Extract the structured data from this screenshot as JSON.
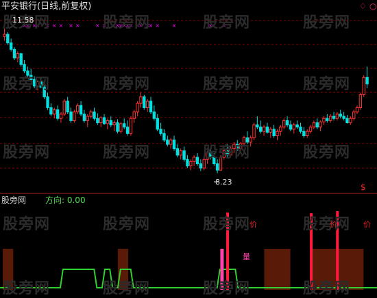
{
  "header": {
    "title": "平安银行(日线,前复权)",
    "settings_glyph": "♢",
    "close_glyph": "○"
  },
  "price": {
    "high_label": "11.58",
    "low_label": "8.23",
    "high_value": 11.58,
    "low_value": 8.23,
    "dollar_marker": "$"
  },
  "indicator": {
    "name": "股旁网",
    "direction_label": "方向: 0.00"
  },
  "watermark": "股旁网",
  "signals": {
    "price_tag": "价",
    "volume_tag": "量"
  },
  "colors": {
    "up": "#ff3232",
    "down": "#00e0e0",
    "grid": "#8b0000",
    "direction_line": "#30d030",
    "band": "#5a1a08",
    "signal_bar": "#ff1a3c",
    "marker": "#ff00ff"
  },
  "chart_data": {
    "type": "candlestick",
    "y_range": [
      8.0,
      11.8
    ],
    "candles": [
      [
        11.4,
        11.58,
        11.3,
        11.45
      ],
      [
        11.45,
        11.5,
        11.2,
        11.25
      ],
      [
        11.25,
        11.35,
        11.05,
        11.1
      ],
      [
        11.1,
        11.15,
        10.85,
        10.9
      ],
      [
        10.9,
        11.05,
        10.8,
        11.0
      ],
      [
        11.0,
        11.02,
        10.7,
        10.75
      ],
      [
        10.75,
        10.85,
        10.55,
        10.6
      ],
      [
        10.6,
        10.7,
        10.45,
        10.5
      ],
      [
        10.5,
        10.65,
        10.35,
        10.4
      ],
      [
        10.4,
        10.48,
        10.2,
        10.25
      ],
      [
        10.25,
        10.4,
        10.15,
        10.35
      ],
      [
        10.35,
        10.45,
        10.2,
        10.22
      ],
      [
        10.22,
        10.3,
        9.95,
        10.0
      ],
      [
        10.0,
        10.1,
        9.7,
        9.75
      ],
      [
        9.75,
        9.85,
        9.55,
        9.6
      ],
      [
        9.6,
        9.75,
        9.5,
        9.7
      ],
      [
        9.7,
        9.8,
        9.45,
        9.5
      ],
      [
        9.5,
        9.65,
        9.4,
        9.6
      ],
      [
        9.6,
        9.95,
        9.55,
        9.9
      ],
      [
        9.9,
        10.0,
        9.6,
        9.65
      ],
      [
        9.65,
        9.75,
        9.4,
        9.45
      ],
      [
        9.45,
        9.7,
        9.4,
        9.65
      ],
      [
        9.65,
        9.85,
        9.6,
        9.8
      ],
      [
        9.8,
        9.9,
        9.55,
        9.6
      ],
      [
        9.6,
        9.7,
        9.4,
        9.45
      ],
      [
        9.45,
        9.6,
        9.3,
        9.55
      ],
      [
        9.55,
        9.7,
        9.5,
        9.65
      ],
      [
        9.65,
        9.75,
        9.45,
        9.5
      ],
      [
        9.5,
        9.62,
        9.35,
        9.4
      ],
      [
        9.4,
        9.55,
        9.3,
        9.52
      ],
      [
        9.52,
        9.6,
        9.35,
        9.38
      ],
      [
        9.38,
        9.5,
        9.25,
        9.45
      ],
      [
        9.45,
        9.55,
        9.3,
        9.35
      ],
      [
        9.35,
        9.45,
        9.2,
        9.4
      ],
      [
        9.4,
        9.48,
        9.15,
        9.2
      ],
      [
        9.2,
        9.42,
        9.15,
        9.38
      ],
      [
        9.38,
        9.5,
        9.25,
        9.3
      ],
      [
        9.3,
        9.45,
        9.1,
        9.15
      ],
      [
        9.15,
        9.55,
        9.1,
        9.5
      ],
      [
        9.5,
        9.7,
        9.4,
        9.65
      ],
      [
        9.65,
        9.9,
        9.55,
        9.85
      ],
      [
        9.85,
        10.1,
        9.75,
        10.0
      ],
      [
        10.0,
        10.05,
        9.7,
        9.75
      ],
      [
        9.75,
        9.95,
        9.65,
        9.9
      ],
      [
        9.9,
        10.0,
        9.6,
        9.65
      ],
      [
        9.65,
        9.8,
        9.45,
        9.5
      ],
      [
        9.5,
        9.6,
        9.2,
        9.25
      ],
      [
        9.25,
        9.4,
        9.1,
        9.15
      ],
      [
        9.15,
        9.25,
        8.95,
        9.0
      ],
      [
        9.0,
        9.1,
        8.85,
        8.9
      ],
      [
        8.9,
        9.05,
        8.8,
        9.0
      ],
      [
        9.0,
        9.1,
        8.75,
        8.8
      ],
      [
        8.8,
        8.9,
        8.6,
        8.65
      ],
      [
        8.65,
        8.8,
        8.55,
        8.75
      ],
      [
        8.75,
        8.85,
        8.5,
        8.55
      ],
      [
        8.55,
        8.65,
        8.35,
        8.4
      ],
      [
        8.4,
        8.55,
        8.3,
        8.5
      ],
      [
        8.5,
        8.65,
        8.4,
        8.6
      ],
      [
        8.6,
        8.7,
        8.4,
        8.45
      ],
      [
        8.45,
        8.55,
        8.28,
        8.35
      ],
      [
        8.35,
        8.6,
        8.3,
        8.55
      ],
      [
        8.55,
        8.75,
        8.45,
        8.7
      ],
      [
        8.7,
        8.8,
        8.55,
        8.6
      ],
      [
        8.6,
        8.7,
        8.4,
        8.45
      ],
      [
        8.45,
        8.55,
        8.23,
        8.3
      ],
      [
        8.3,
        8.65,
        8.28,
        8.6
      ],
      [
        8.6,
        8.8,
        8.55,
        8.75
      ],
      [
        8.75,
        8.9,
        8.6,
        8.65
      ],
      [
        8.65,
        8.85,
        8.6,
        8.8
      ],
      [
        8.8,
        8.95,
        8.7,
        8.9
      ],
      [
        8.9,
        9.0,
        8.75,
        8.8
      ],
      [
        8.8,
        8.95,
        8.7,
        8.92
      ],
      [
        8.92,
        9.1,
        8.85,
        9.05
      ],
      [
        9.05,
        9.2,
        8.9,
        8.95
      ],
      [
        8.95,
        9.1,
        8.85,
        9.05
      ],
      [
        9.05,
        9.4,
        9.0,
        9.35
      ],
      [
        9.35,
        9.55,
        9.25,
        9.3
      ],
      [
        9.3,
        9.45,
        9.15,
        9.2
      ],
      [
        9.2,
        9.35,
        9.1,
        9.3
      ],
      [
        9.3,
        9.4,
        9.15,
        9.18
      ],
      [
        9.18,
        9.3,
        9.05,
        9.25
      ],
      [
        9.25,
        9.35,
        9.05,
        9.1
      ],
      [
        9.1,
        9.25,
        9.0,
        9.2
      ],
      [
        9.2,
        9.35,
        9.1,
        9.3
      ],
      [
        9.3,
        9.5,
        9.25,
        9.45
      ],
      [
        9.45,
        9.55,
        9.3,
        9.35
      ],
      [
        9.35,
        9.45,
        9.2,
        9.25
      ],
      [
        9.25,
        9.4,
        9.15,
        9.35
      ],
      [
        9.35,
        9.45,
        9.25,
        9.3
      ],
      [
        9.3,
        9.4,
        9.15,
        9.2
      ],
      [
        9.2,
        9.3,
        9.05,
        9.1
      ],
      [
        9.1,
        9.25,
        9.05,
        9.2
      ],
      [
        9.2,
        9.35,
        9.15,
        9.3
      ],
      [
        9.3,
        9.45,
        9.25,
        9.4
      ],
      [
        9.4,
        9.5,
        9.25,
        9.3
      ],
      [
        9.3,
        9.45,
        9.2,
        9.42
      ],
      [
        9.42,
        9.55,
        9.35,
        9.5
      ],
      [
        9.5,
        9.6,
        9.4,
        9.45
      ],
      [
        9.45,
        9.6,
        9.4,
        9.55
      ],
      [
        9.55,
        9.65,
        9.45,
        9.5
      ],
      [
        9.5,
        9.65,
        9.45,
        9.6
      ],
      [
        9.6,
        9.7,
        9.5,
        9.55
      ],
      [
        9.55,
        9.65,
        9.45,
        9.5
      ],
      [
        9.5,
        9.58,
        9.38,
        9.4
      ],
      [
        9.4,
        9.55,
        9.35,
        9.5
      ],
      [
        9.5,
        9.7,
        9.45,
        9.65
      ],
      [
        9.65,
        9.8,
        9.6,
        9.75
      ],
      [
        9.75,
        10.1,
        9.7,
        10.05
      ],
      [
        10.05,
        10.5,
        10.0,
        10.45
      ],
      [
        10.45,
        10.7,
        10.2,
        10.3
      ]
    ],
    "purple_marks_x": [
      6,
      7,
      9,
      10,
      13,
      15,
      17,
      20,
      22,
      28,
      30,
      34,
      35,
      36,
      37,
      38,
      40,
      41,
      43,
      44,
      46,
      51,
      62,
      66
    ],
    "direction_plateaus": [
      [
        11,
        18
      ],
      [
        19,
        21
      ],
      [
        22,
        25
      ],
      [
        41,
        45
      ]
    ],
    "bands": [
      [
        0,
        2
      ],
      [
        22,
        24
      ],
      [
        50,
        55
      ],
      [
        59,
        69
      ]
    ],
    "signal_bars": [
      [
        43,
        0.45
      ],
      [
        59,
        0.4
      ],
      [
        64,
        0.55
      ]
    ],
    "volume_bar": 42
  }
}
